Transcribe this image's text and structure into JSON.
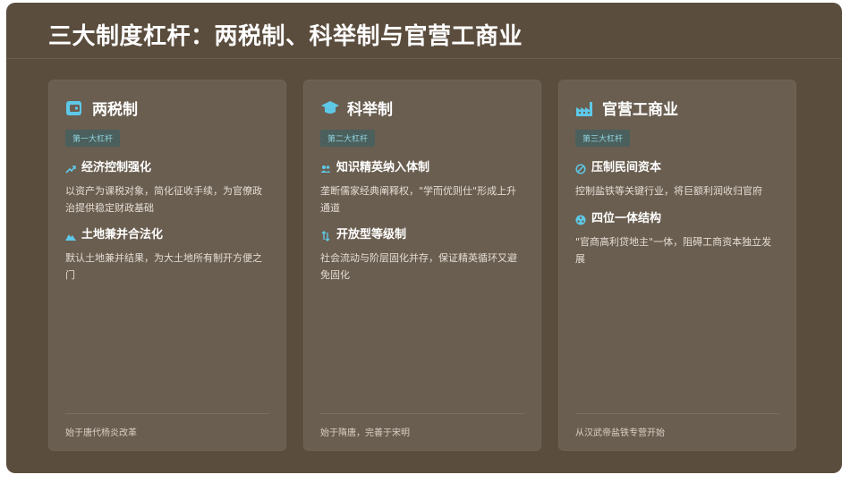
{
  "page": {
    "title": "三大制度杠杆：两税制、科举制与官营工商业"
  },
  "colors": {
    "background": "#5b4d3e",
    "card": "#6a5e50",
    "accent": "#5ec8e8",
    "badge_bg": "#4b5f5c",
    "badge_text": "#8fd3dd"
  },
  "cards": [
    {
      "icon": "wallet-icon",
      "title": "两税制",
      "badge": "第一大杠杆",
      "points": [
        {
          "icon": "trend-up-icon",
          "title": "经济控制强化",
          "text": "以资产为课税对象，简化征收手续，为官僚政治提供稳定财政基础"
        },
        {
          "icon": "mountain-icon",
          "title": "土地兼并合法化",
          "text": "默认土地兼并结果，为大土地所有制开方便之门"
        }
      ],
      "footer": "始于唐代杨炎改革"
    },
    {
      "icon": "graduation-cap-icon",
      "title": "科举制",
      "badge": "第二大杠杆",
      "points": [
        {
          "icon": "users-icon",
          "title": "知识精英纳入体制",
          "text": "垄断儒家经典阐释权，\"学而优则仕\"形成上升通道"
        },
        {
          "icon": "exchange-icon",
          "title": "开放型等级制",
          "text": "社会流动与阶层固化并存，保证精英循环又避免固化"
        }
      ],
      "footer": "始于隋唐，完善于宋明"
    },
    {
      "icon": "industry-icon",
      "title": "官营工商业",
      "badge": "第三大杠杆",
      "points": [
        {
          "icon": "ban-icon",
          "title": "压制民间资本",
          "text": "控制盐铁等关键行业，将巨额利润收归官府"
        },
        {
          "icon": "nodes-icon",
          "title": "四位一体结构",
          "text": "\"官商高利贷地主\"一体，阻碍工商资本独立发展"
        }
      ],
      "footer": "从汉武帝盐铁专营开始"
    }
  ]
}
